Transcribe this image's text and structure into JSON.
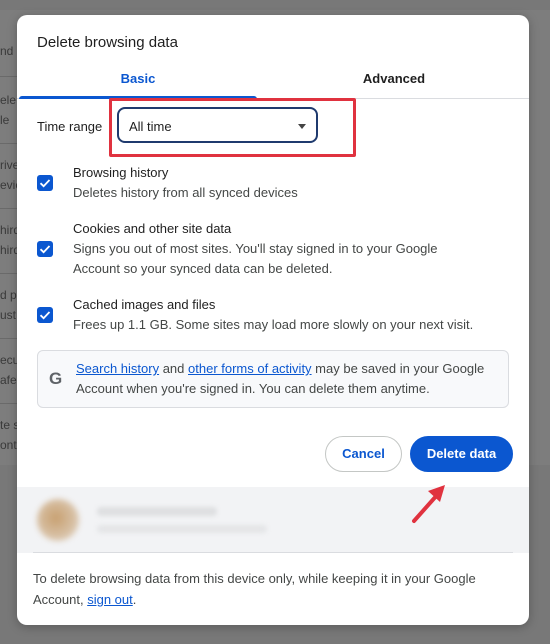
{
  "dialog": {
    "title": "Delete browsing data",
    "tabs": [
      {
        "label": "Basic",
        "selected": true
      },
      {
        "label": "Advanced",
        "selected": false
      }
    ],
    "time_range": {
      "label": "Time range",
      "value": "All time"
    },
    "options": [
      {
        "title": "Browsing history",
        "desc_lines": [
          "Deletes history from all synced devices"
        ],
        "checked": true
      },
      {
        "title": "Cookies and other site data",
        "desc_lines": [
          "Signs you out of most sites. You'll stay signed in to your Google",
          "Account so your synced data can be deleted."
        ],
        "checked": true
      },
      {
        "title": "Cached images and files",
        "desc_lines": [
          "Frees up 1.1 GB. Some sites may load more slowly on your next visit."
        ],
        "checked": true
      }
    ],
    "info": {
      "icon": "google-g-icon",
      "link1": "Search history",
      "and": " and ",
      "link2": "other forms of activity",
      "rest": " may be saved in your Google Account when you're signed in. You can delete them anytime."
    },
    "buttons": {
      "cancel": "Cancel",
      "delete": "Delete data"
    },
    "footer": {
      "text": "To delete browsing data from this device only, while keeping it in your Google Account, ",
      "link": "sign out",
      "end": "."
    }
  },
  "background_fragments": [
    "nd s",
    "ele",
    "le",
    "rive",
    "evic",
    "hird",
    "hird",
    "d p",
    "ust",
    "ecu",
    "afe",
    "te s",
    "ont"
  ],
  "colors": {
    "accent": "#0b57d0",
    "annotation_red": "#e0323f"
  }
}
